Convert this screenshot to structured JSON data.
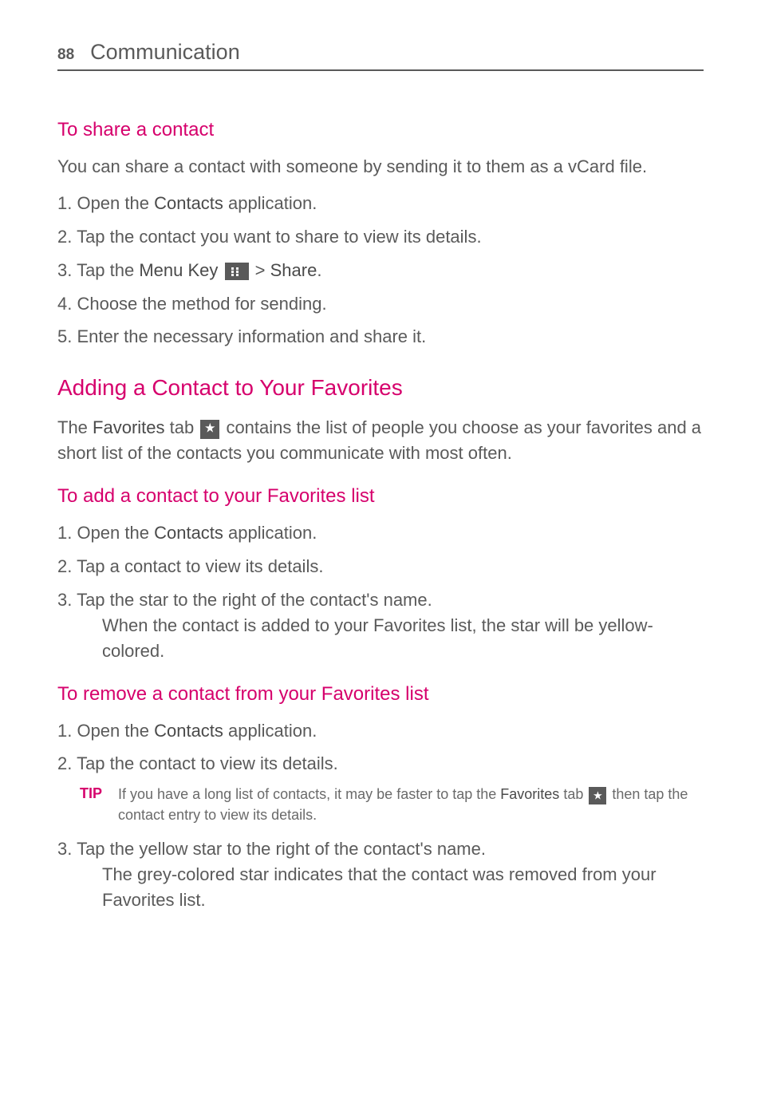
{
  "header": {
    "page_number": "88",
    "chapter": "Communication"
  },
  "sections": {
    "share_contact": {
      "title": "To share a contact",
      "intro": "You can share a contact with someone by sending it to them as a vCard file.",
      "step1_prefix": "1.  Open the ",
      "step1_bold": "Contacts",
      "step1_suffix": " application.",
      "step2": "2. Tap the contact you want to share to view its details.",
      "step3_prefix": "3. Tap the ",
      "step3_bold1": "Menu Key",
      "step3_gt": " > ",
      "step3_bold2": "Share",
      "step3_suffix": ".",
      "step4": "4. Choose the method for sending.",
      "step5": "5. Enter the necessary information and share it."
    },
    "adding_favorites": {
      "heading": "Adding a Contact to Your Favorites",
      "intro_prefix": "The ",
      "intro_bold": "Favorites",
      "intro_mid": " tab ",
      "intro_suffix": " contains the list of people you choose as your favorites and a short list of the contacts you communicate with most often."
    },
    "add_to_fav": {
      "title": "To add a contact to your Favorites list",
      "step1_prefix": "1.  Open the ",
      "step1_bold": "Contacts",
      "step1_suffix": " application.",
      "step2": "2. Tap a contact to view its details.",
      "step3_line1": "3. Tap the star to the right of the contact's name.",
      "step3_line2": "When the contact is added to your Favorites list, the star will be yellow-colored."
    },
    "remove_fav": {
      "title": "To remove a contact from your Favorites list",
      "step1_prefix": "1.  Open the ",
      "step1_bold": "Contacts",
      "step1_suffix": " application.",
      "step2": "2. Tap the contact to view its details.",
      "tip_label": "TIP",
      "tip_prefix": "If you have a long list of contacts, it may be faster to tap the ",
      "tip_bold": "Favorites",
      "tip_mid": " tab ",
      "tip_suffix": " then tap the contact entry to view its details.",
      "step3_line1": "3. Tap the yellow star to the right of the contact's name.",
      "step3_line2": "The grey-colored star indicates that the contact was removed from your Favorites list."
    }
  }
}
